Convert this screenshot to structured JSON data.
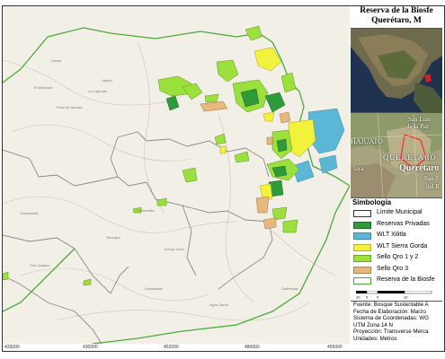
{
  "title": {
    "line1": "Reserva de la Biosfe",
    "line2": "Querétaro, M"
  },
  "inset_labels": {
    "san_luis": "San Luis",
    "de_la_paz": "de la Paz",
    "hajuato": "HAJUATO",
    "queretaro_caps": "QUERETARO",
    "queretaro": "Querétaro",
    "laya": "laya",
    "san_j": "San J",
    "del_r": "del R"
  },
  "map_places": [
    "Landa",
    "El Madrone",
    "Jalpan",
    "La Lagunita",
    "Pinal de Amoles",
    "Peñamiller",
    "Tancoyol",
    "Arroyo Seco",
    "Escanelilla",
    "San Joaquín",
    "Cadereyta",
    "Agua Zarca",
    "Ahuacatlán"
  ],
  "legend": {
    "title": "Simbología",
    "items": [
      {
        "label": "Límite Municipal",
        "color": "#ffffff",
        "border": "#333333"
      },
      {
        "label": "Reservas Privadas",
        "color": "#2e9a3a",
        "border": "#1f6b28"
      },
      {
        "label": "WLT Xilitla",
        "color": "#5ab8d6",
        "border": "#3b8aa3"
      },
      {
        "label": "WLT Sierra Gorda",
        "color": "#f2f23c",
        "border": "#b5b52a"
      },
      {
        "label": "Sello Qro 1 y 2",
        "color": "#9be03c",
        "border": "#6aa827"
      },
      {
        "label": "Sello Qro 3",
        "color": "#e8b77c",
        "border": "#b08555"
      },
      {
        "label": "Reserva de la Biosfe",
        "color": "#ffffff",
        "border": "#4caa3c"
      }
    ],
    "scale_ticks": [
      "10",
      "5",
      "0",
      "10"
    ]
  },
  "credits": [
    "Fuente: Bosque Sustentable A",
    "Fecha de Elaboración: Marzo",
    "Sistema de Coordenadas: WG",
    "UTM Zona 14 N",
    "Proyección: Transverse Merca",
    "Unidades: Metros"
  ],
  "x_ticks": [
    "433000",
    "430000",
    "453000",
    "480000",
    "455000"
  ],
  "colors": {
    "reservas_privadas": "#2e9a3a",
    "wlt_xilitla": "#5ab8d6",
    "wlt_sierra_gorda": "#f2f23c",
    "sello_qro_1y2": "#9be03c",
    "sello_qro_3": "#e8b77c",
    "biosfera_border": "#4caa3c"
  }
}
